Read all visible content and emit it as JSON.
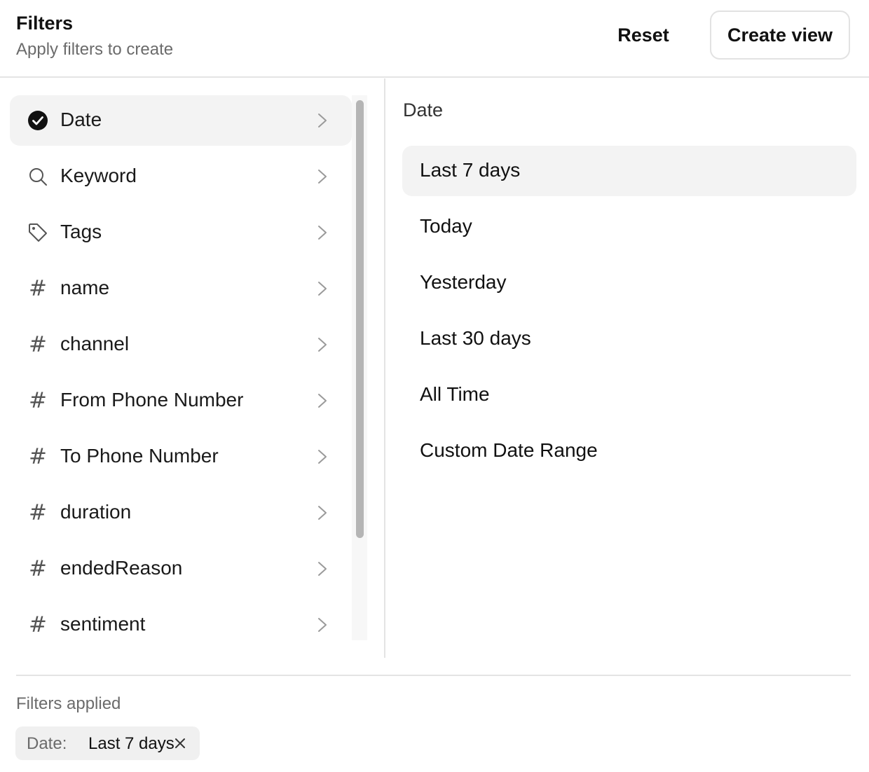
{
  "header": {
    "title": "Filters",
    "subtitle": "Apply filters to create",
    "reset_label": "Reset",
    "create_label": "Create view"
  },
  "filters": [
    {
      "label": "Date",
      "icon": "check-circle-icon",
      "active": true
    },
    {
      "label": "Keyword",
      "icon": "search-icon",
      "active": false
    },
    {
      "label": "Tags",
      "icon": "tag-icon",
      "active": false
    },
    {
      "label": "name",
      "icon": "hash-icon",
      "active": false
    },
    {
      "label": "channel",
      "icon": "hash-icon",
      "active": false
    },
    {
      "label": "From Phone Number",
      "icon": "hash-icon",
      "active": false
    },
    {
      "label": "To Phone Number",
      "icon": "hash-icon",
      "active": false
    },
    {
      "label": "duration",
      "icon": "hash-icon",
      "active": false
    },
    {
      "label": "endedReason",
      "icon": "hash-icon",
      "active": false
    },
    {
      "label": "sentiment",
      "icon": "hash-icon",
      "active": false
    }
  ],
  "detail": {
    "title": "Date",
    "options": [
      {
        "label": "Last 7 days",
        "selected": true
      },
      {
        "label": "Today",
        "selected": false
      },
      {
        "label": "Yesterday",
        "selected": false
      },
      {
        "label": "Last 30 days",
        "selected": false
      },
      {
        "label": "All Time",
        "selected": false
      },
      {
        "label": "Custom Date Range",
        "selected": false
      }
    ]
  },
  "applied": {
    "title": "Filters applied",
    "chips": [
      {
        "key": "Date:",
        "value": "Last 7 days"
      }
    ]
  },
  "colors": {
    "active_bg": "#f3f3f3",
    "divider": "#e4e4e4",
    "muted_text": "#6b6b6b",
    "scroll_thumb": "#b5b5b5"
  }
}
